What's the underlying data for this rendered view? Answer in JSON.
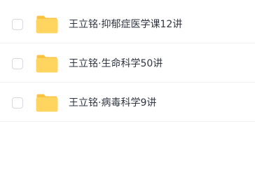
{
  "files": [
    {
      "name": "王立铭·抑郁症医学课12讲",
      "icon": "folder-icon",
      "selected": false
    },
    {
      "name": "王立铭·生命科学50讲",
      "icon": "folder-icon",
      "selected": false
    },
    {
      "name": "王立铭·病毒科学9讲",
      "icon": "folder-icon",
      "selected": false
    }
  ],
  "colors": {
    "folder": "#ffd55f",
    "folder_tab": "#f9c443",
    "text": "#2f3542",
    "checkbox_border": "#d6d9de",
    "divider": "#f0f1f3"
  }
}
